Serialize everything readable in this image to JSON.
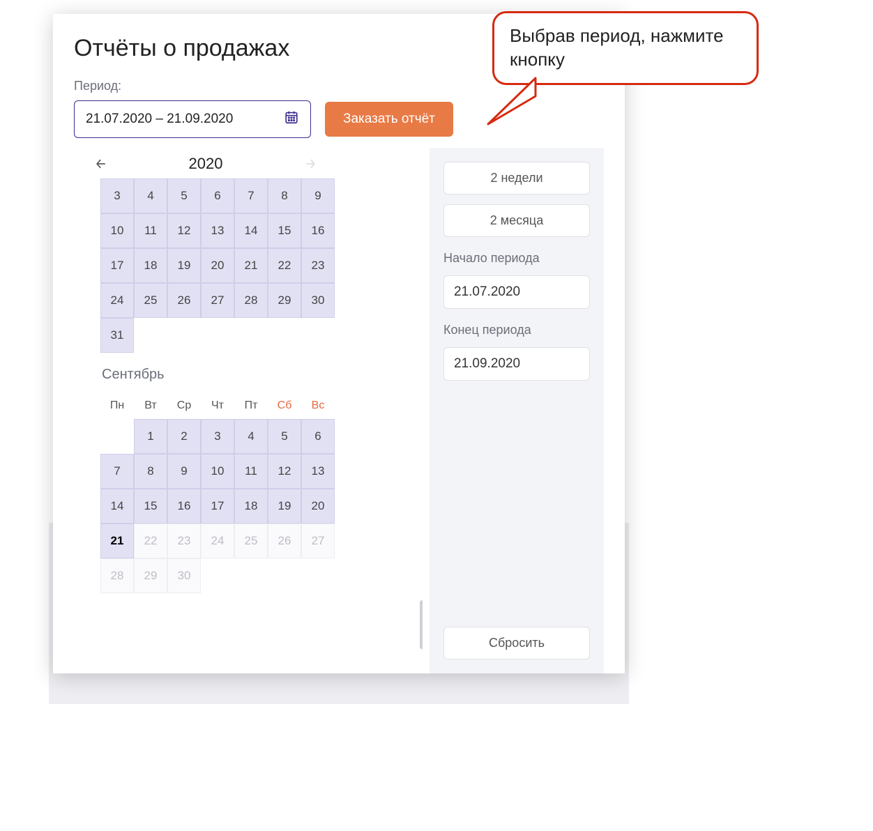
{
  "page": {
    "title": "Отчёты о продажах",
    "period_label": "Период:",
    "date_range_value": "21.07.2020 – 21.09.2020",
    "order_button_label": "Заказать отчёт"
  },
  "callout": {
    "text": "Выбрав период, нажмите кнопку"
  },
  "calendar": {
    "year": "2020",
    "top_month": {
      "partial_first_row": [
        "3",
        "4",
        "5",
        "6",
        "7",
        "8",
        "9"
      ],
      "rows": [
        [
          "10",
          "11",
          "12",
          "13",
          "14",
          "15",
          "16"
        ],
        [
          "17",
          "18",
          "19",
          "20",
          "21",
          "22",
          "23"
        ],
        [
          "24",
          "25",
          "26",
          "27",
          "28",
          "29",
          "30"
        ]
      ],
      "tail": [
        "31"
      ]
    },
    "september": {
      "name": "Сентябрь",
      "weekdays": [
        "Пн",
        "Вт",
        "Ср",
        "Чт",
        "Пт",
        "Сб",
        "Вс"
      ],
      "lead_empty": 1,
      "days": [
        {
          "n": "1",
          "state": "in"
        },
        {
          "n": "2",
          "state": "in"
        },
        {
          "n": "3",
          "state": "in"
        },
        {
          "n": "4",
          "state": "in"
        },
        {
          "n": "5",
          "state": "in"
        },
        {
          "n": "6",
          "state": "in"
        },
        {
          "n": "7",
          "state": "in"
        },
        {
          "n": "8",
          "state": "in"
        },
        {
          "n": "9",
          "state": "in"
        },
        {
          "n": "10",
          "state": "in"
        },
        {
          "n": "11",
          "state": "in"
        },
        {
          "n": "12",
          "state": "in"
        },
        {
          "n": "13",
          "state": "in"
        },
        {
          "n": "14",
          "state": "in"
        },
        {
          "n": "15",
          "state": "in"
        },
        {
          "n": "16",
          "state": "in"
        },
        {
          "n": "17",
          "state": "in"
        },
        {
          "n": "18",
          "state": "in"
        },
        {
          "n": "19",
          "state": "in"
        },
        {
          "n": "20",
          "state": "in"
        },
        {
          "n": "21",
          "state": "end"
        },
        {
          "n": "22",
          "state": "out"
        },
        {
          "n": "23",
          "state": "out"
        },
        {
          "n": "24",
          "state": "out"
        },
        {
          "n": "25",
          "state": "out"
        },
        {
          "n": "26",
          "state": "out"
        },
        {
          "n": "27",
          "state": "out"
        },
        {
          "n": "28",
          "state": "out"
        },
        {
          "n": "29",
          "state": "out"
        },
        {
          "n": "30",
          "state": "out"
        }
      ]
    }
  },
  "sidebar": {
    "preset_2weeks": "2 недели",
    "preset_2months": "2 месяца",
    "start_label": "Начало периода",
    "start_value": "21.07.2020",
    "end_label": "Конец периода",
    "end_value": "21.09.2020",
    "reset_label": "Сбросить"
  }
}
